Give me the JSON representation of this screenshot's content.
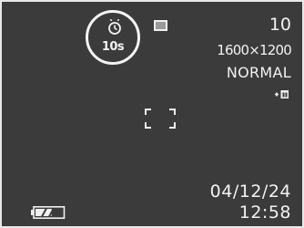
{
  "viewfinder": {
    "self_timer": {
      "icon": "self-timer-icon",
      "label": "10s"
    },
    "flash_mode_icon": "flash-mode-icon",
    "shots_remaining": "10",
    "resolution": "1600×1200",
    "quality": "NORMAL",
    "memory_icon": "memory-icon",
    "focus_frame_icon": "focus-frame-icon",
    "date": "04/12/24",
    "time": "12:58",
    "battery": {
      "icon": "battery-icon",
      "level": 0.6
    }
  },
  "colors": {
    "background": "#3b3b3b",
    "foreground": "#f2f2f2"
  }
}
